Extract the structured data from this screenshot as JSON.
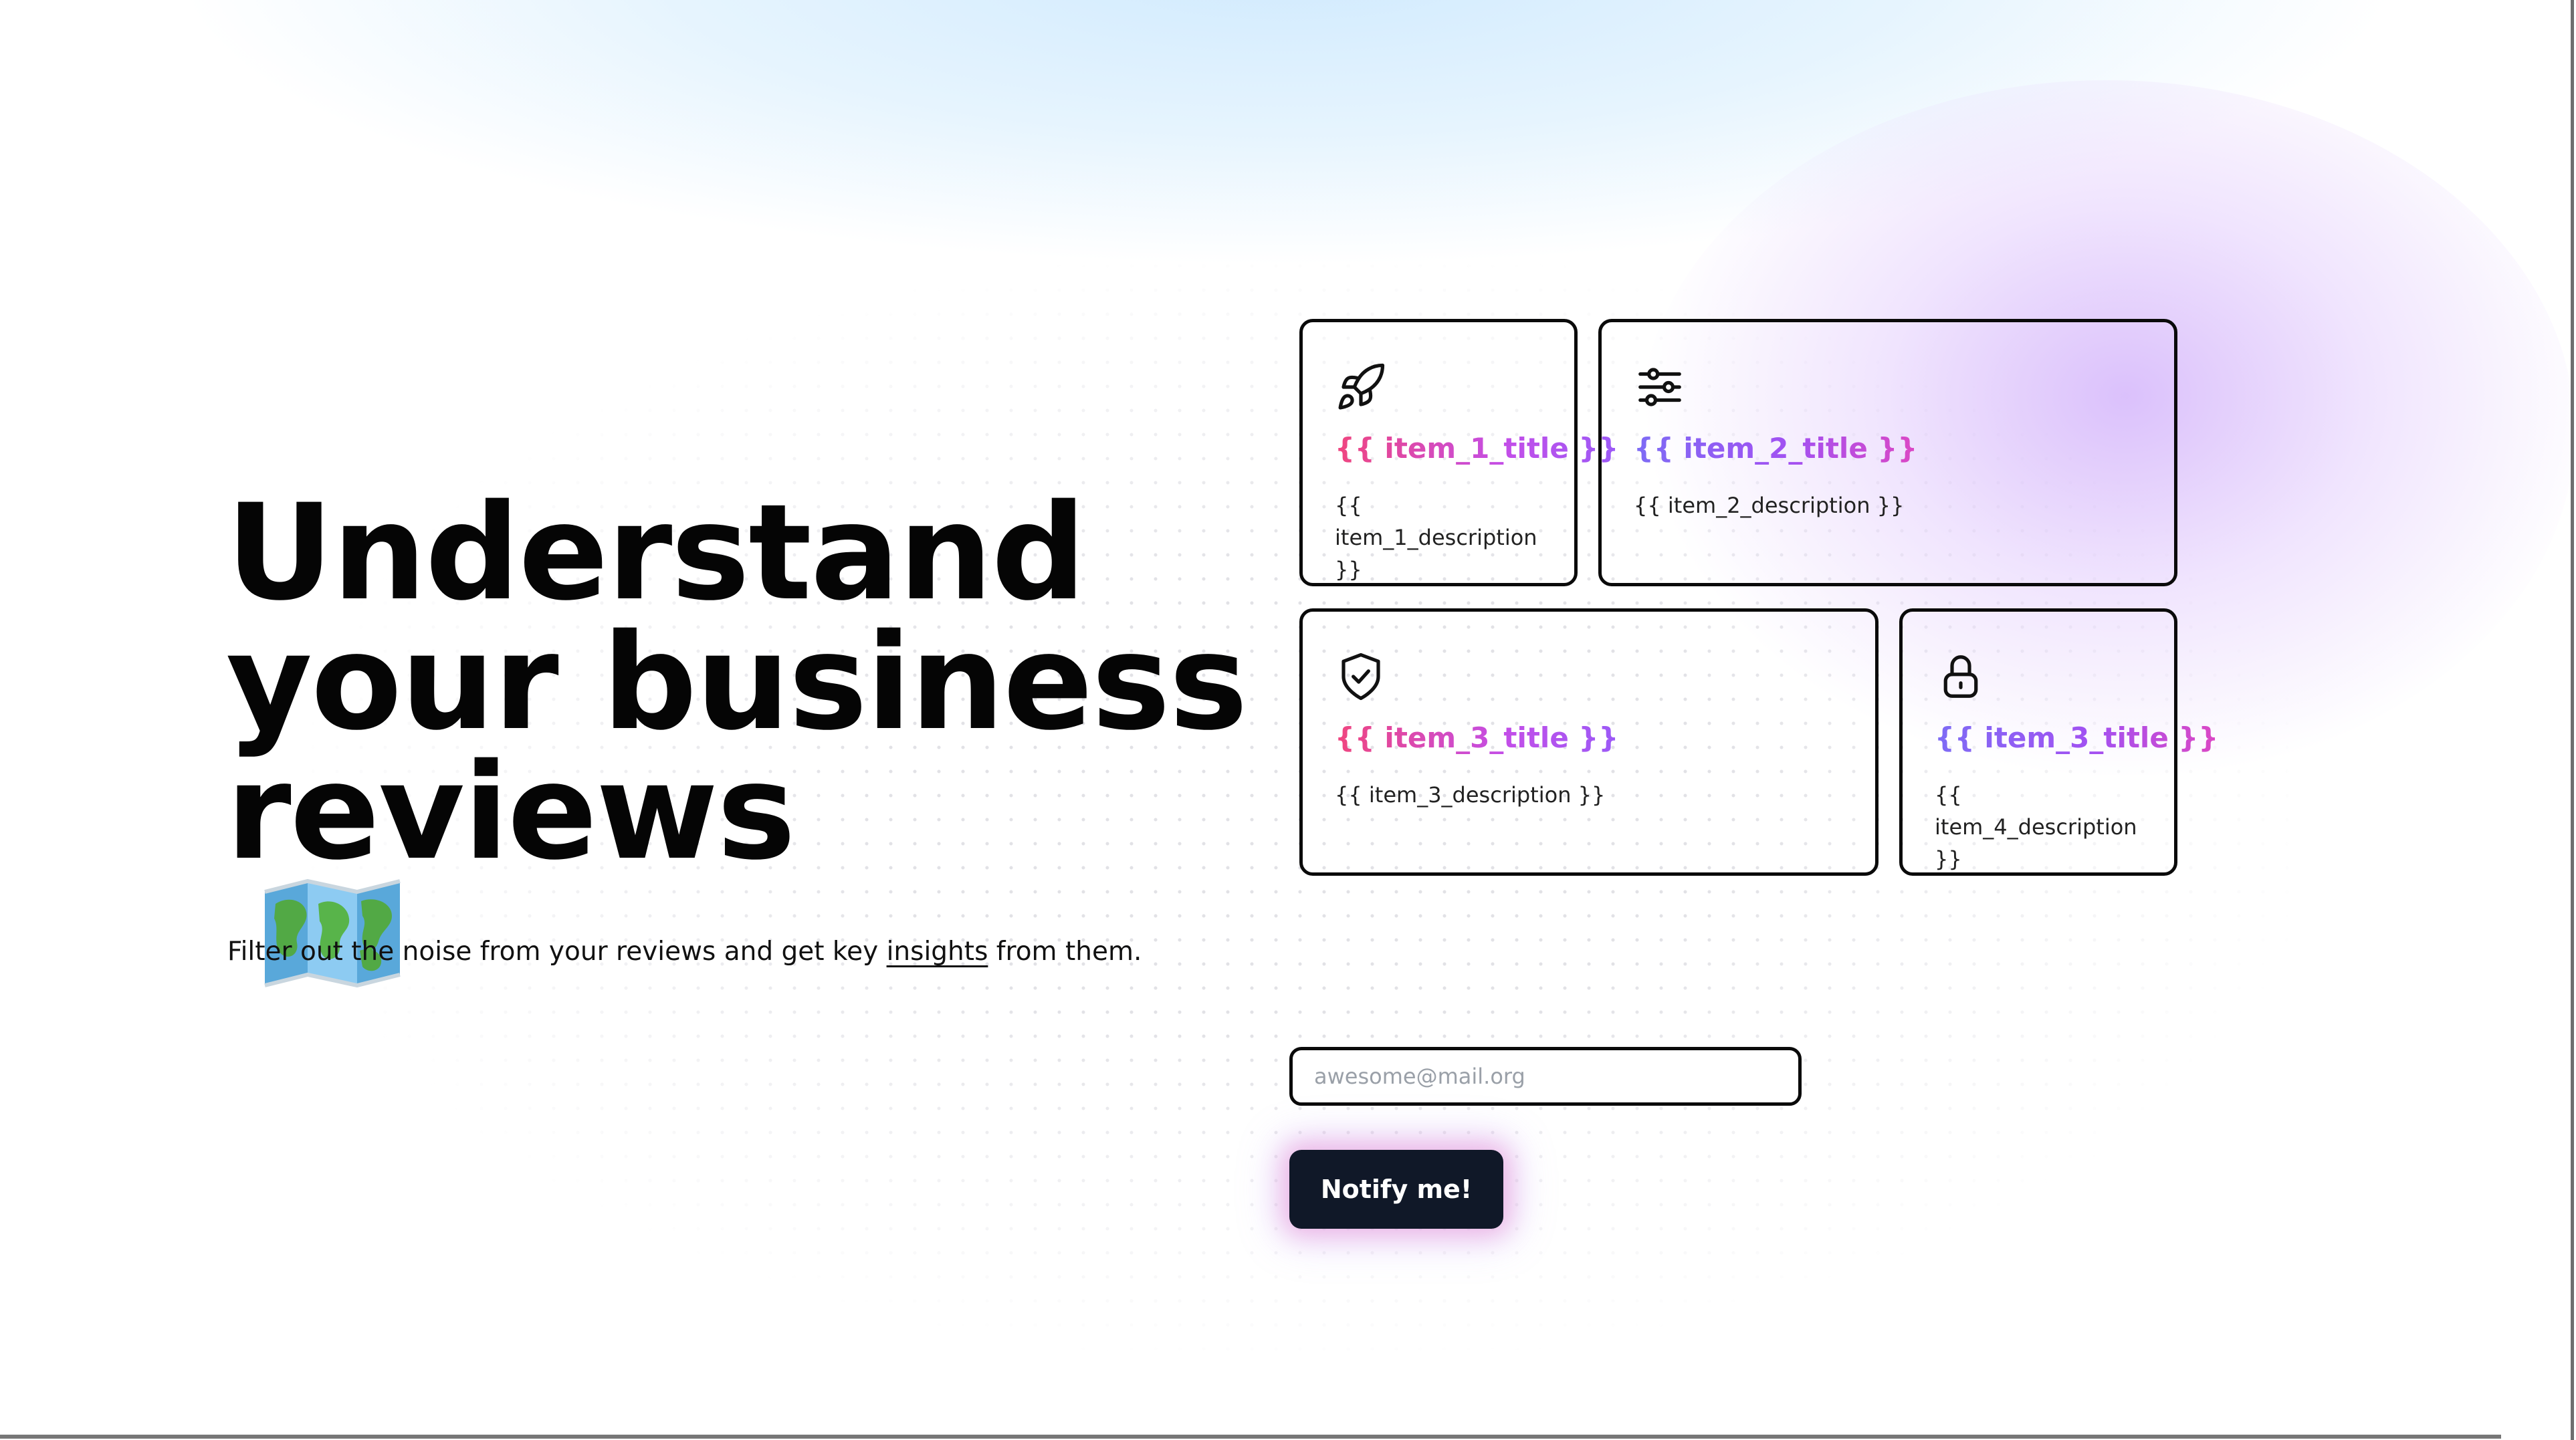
{
  "hero": {
    "title_lines": [
      "Understand",
      "your business",
      "reviews"
    ],
    "title_emoji": "world-map-icon",
    "subtitle_before": "Filter out the noise from your reviews and get key ",
    "subtitle_link": "insights",
    "subtitle_after": " from them."
  },
  "features": [
    {
      "icon": "rocket-icon",
      "title": "{{ item_1_title }}",
      "description": "{{ item_1_description }}"
    },
    {
      "icon": "sliders-icon",
      "title": "{{ item_2_title }}",
      "description": "{{ item_2_description }}"
    },
    {
      "icon": "shield-check-icon",
      "title": "{{ item_3_title }}",
      "description": "{{ item_3_description }}"
    },
    {
      "icon": "lock-icon",
      "title": "{{ item_3_title }}",
      "description": "{{ item_4_description }}"
    }
  ],
  "signup": {
    "email_value": "",
    "email_placeholder": "awesome@mail.org",
    "button_label": "Notify me!"
  },
  "colors": {
    "text": "#050505",
    "button_bg": "#101828",
    "title_gradient_start": "#f0457e",
    "title_gradient_end": "#9b5af7",
    "accent_purple": "#d7bafb",
    "accent_blue": "#cee9fd"
  }
}
